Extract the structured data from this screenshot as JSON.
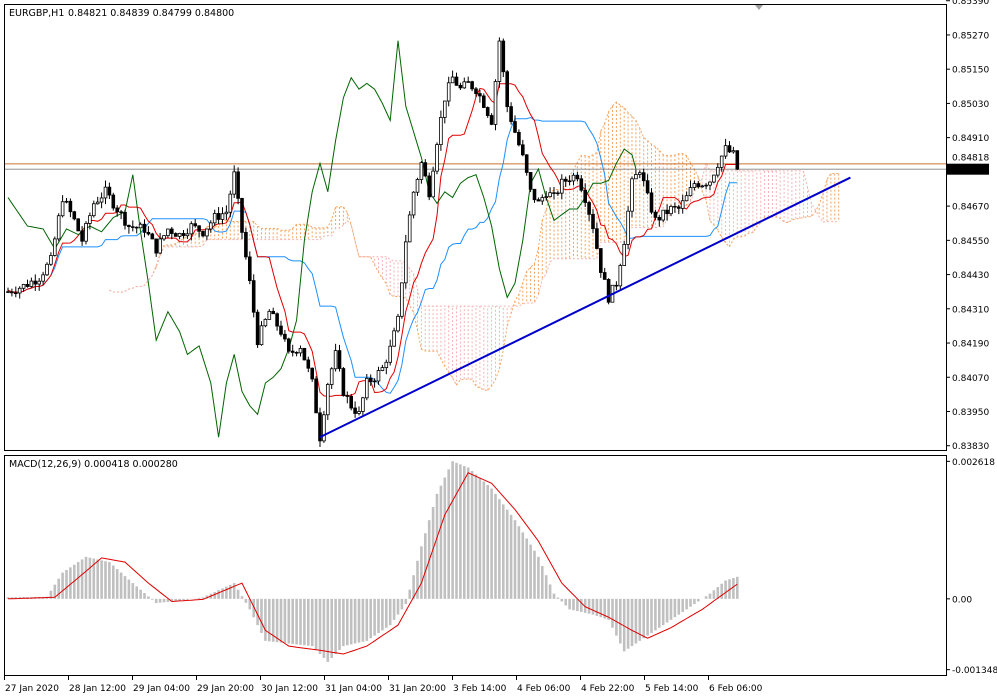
{
  "chart_data": {
    "type": "candlestick",
    "symbol_header": "EURGBP,H1",
    "ohlc_header": "0.84821 0.84839 0.84799 0.84800",
    "price_axis": {
      "ylim": [
        0.83815,
        0.85375
      ],
      "ticks": [
        "0.85390",
        "0.85270",
        "0.85150",
        "0.85030",
        "0.84910",
        "0.84670",
        "0.84550",
        "0.84430",
        "0.84310",
        "0.84190",
        "0.84070",
        "0.83950",
        "0.83830"
      ],
      "current_price_label": "0.84800",
      "hidden_level_label": "0.84818",
      "price_level_color": "#c87533",
      "current_price_tag_color": "#000000"
    },
    "time_axis": {
      "labels": [
        "27 Jan 2020",
        "28 Jan 12:00",
        "29 Jan 04:00",
        "29 Jan 20:00",
        "30 Jan 12:00",
        "31 Jan 04:00",
        "31 Jan 20:00",
        "3 Feb 14:00",
        "4 Feb 06:00",
        "4 Feb 22:00",
        "5 Feb 14:00",
        "6 Feb 06:00"
      ]
    },
    "close_path": [
      [
        0,
        0.8437
      ],
      [
        4,
        0.8439
      ],
      [
        8,
        0.8442
      ],
      [
        11,
        0.8448
      ],
      [
        14,
        0.847
      ],
      [
        17,
        0.8462
      ],
      [
        19,
        0.8455
      ],
      [
        22,
        0.8468
      ],
      [
        25,
        0.8472
      ],
      [
        28,
        0.8466
      ],
      [
        31,
        0.846
      ],
      [
        35,
        0.8459
      ],
      [
        38,
        0.8452
      ],
      [
        41,
        0.8459
      ],
      [
        44,
        0.8457
      ],
      [
        47,
        0.846
      ],
      [
        50,
        0.8458
      ],
      [
        53,
        0.8463
      ],
      [
        56,
        0.8465
      ],
      [
        58,
        0.8478
      ],
      [
        60,
        0.8458
      ],
      [
        62,
        0.844
      ],
      [
        64,
        0.842
      ],
      [
        67,
        0.843
      ],
      [
        70,
        0.8423
      ],
      [
        72,
        0.8415
      ],
      [
        75,
        0.8418
      ],
      [
        78,
        0.8405
      ],
      [
        80,
        0.8386
      ],
      [
        82,
        0.8405
      ],
      [
        84,
        0.8415
      ],
      [
        86,
        0.8402
      ],
      [
        88,
        0.8397
      ],
      [
        90,
        0.8394
      ],
      [
        92,
        0.8405
      ],
      [
        94,
        0.8407
      ],
      [
        96,
        0.841
      ],
      [
        98,
        0.8417
      ],
      [
        100,
        0.8427
      ],
      [
        102,
        0.8455
      ],
      [
        104,
        0.8472
      ],
      [
        106,
        0.8482
      ],
      [
        108,
        0.8472
      ],
      [
        110,
        0.849
      ],
      [
        112,
        0.8505
      ],
      [
        114,
        0.8512
      ],
      [
        116,
        0.8508
      ],
      [
        118,
        0.851
      ],
      [
        120,
        0.8508
      ],
      [
        122,
        0.8503
      ],
      [
        124,
        0.8497
      ],
      [
        126,
        0.8525
      ],
      [
        128,
        0.8502
      ],
      [
        130,
        0.8493
      ],
      [
        132,
        0.8484
      ],
      [
        134,
        0.8472
      ],
      [
        136,
        0.8468
      ],
      [
        138,
        0.8472
      ],
      [
        140,
        0.847
      ],
      [
        142,
        0.8475
      ],
      [
        144,
        0.8477
      ],
      [
        146,
        0.8478
      ],
      [
        148,
        0.847
      ],
      [
        150,
        0.846
      ],
      [
        152,
        0.8445
      ],
      [
        154,
        0.8435
      ],
      [
        156,
        0.844
      ],
      [
        158,
        0.8455
      ],
      [
        160,
        0.8475
      ],
      [
        162,
        0.848
      ],
      [
        164,
        0.847
      ],
      [
        166,
        0.8462
      ],
      [
        168,
        0.8464
      ],
      [
        170,
        0.8466
      ],
      [
        172,
        0.8466
      ],
      [
        174,
        0.847
      ],
      [
        176,
        0.8475
      ],
      [
        178,
        0.8475
      ],
      [
        180,
        0.8476
      ],
      [
        182,
        0.8482
      ],
      [
        184,
        0.8487
      ],
      [
        186,
        0.8485
      ],
      [
        187,
        0.848
      ]
    ],
    "trendline": {
      "from": [
        80,
        0.8386
      ],
      "to": [
        216,
        0.8477
      ],
      "color": "#0000cc"
    },
    "ichimoku_colors": {
      "tenkan": "#e00000",
      "kijun": "#1e90ff",
      "chikou": "#006400",
      "cloud_up": "#f4a460",
      "cloud_down": "#f5b5b5"
    },
    "macd": {
      "title": "MACD(12,26,9) 0.000418 0.000280",
      "ticks": [
        "0.002618",
        "0.00",
        "-0.001348"
      ],
      "ylim": [
        -0.00145,
        0.00272
      ],
      "histogram_color": "#c0c0c0",
      "signal_color": "#e00000",
      "hist_keys": [
        [
          0,
          3e-05
        ],
        [
          10,
          4e-05
        ],
        [
          14,
          0.0005
        ],
        [
          20,
          0.0008
        ],
        [
          26,
          0.0007
        ],
        [
          32,
          0.0003
        ],
        [
          38,
          -8e-05
        ],
        [
          44,
          -4e-05
        ],
        [
          50,
          3e-05
        ],
        [
          58,
          0.0003
        ],
        [
          62,
          -0.0002
        ],
        [
          66,
          -0.0008
        ],
        [
          72,
          -0.00085
        ],
        [
          78,
          -0.0009
        ],
        [
          82,
          -0.0012
        ],
        [
          86,
          -0.0009
        ],
        [
          92,
          -0.0008
        ],
        [
          98,
          -0.0005
        ],
        [
          102,
          -0.0001
        ],
        [
          106,
          0.001
        ],
        [
          110,
          0.002
        ],
        [
          114,
          0.00262
        ],
        [
          118,
          0.0025
        ],
        [
          124,
          0.0021
        ],
        [
          130,
          0.0015
        ],
        [
          136,
          0.0008
        ],
        [
          140,
          0.0001
        ],
        [
          144,
          -0.0002
        ],
        [
          150,
          -0.0003
        ],
        [
          154,
          -0.0004
        ],
        [
          158,
          -0.001
        ],
        [
          162,
          -0.0008
        ],
        [
          168,
          -0.0005
        ],
        [
          174,
          -0.0002
        ],
        [
          180,
          0.0001
        ],
        [
          184,
          0.00035
        ],
        [
          187,
          0.00042
        ]
      ],
      "signal_keys": [
        [
          0,
          0.0
        ],
        [
          12,
          3e-05
        ],
        [
          18,
          0.0004
        ],
        [
          24,
          0.00078
        ],
        [
          30,
          0.0007
        ],
        [
          36,
          0.0003
        ],
        [
          42,
          -5e-05
        ],
        [
          50,
          -1e-05
        ],
        [
          60,
          0.0003
        ],
        [
          66,
          -0.0006
        ],
        [
          72,
          -0.0009
        ],
        [
          80,
          -0.00098
        ],
        [
          86,
          -0.00105
        ],
        [
          92,
          -0.0009
        ],
        [
          100,
          -0.0005
        ],
        [
          106,
          0.0003
        ],
        [
          112,
          0.0016
        ],
        [
          118,
          0.0024
        ],
        [
          124,
          0.0022
        ],
        [
          130,
          0.0017
        ],
        [
          136,
          0.0011
        ],
        [
          142,
          0.0003
        ],
        [
          148,
          -0.00015
        ],
        [
          154,
          -0.00035
        ],
        [
          160,
          -0.0006
        ],
        [
          164,
          -0.00075
        ],
        [
          170,
          -0.00055
        ],
        [
          178,
          -0.0002
        ],
        [
          187,
          0.00028
        ]
      ]
    }
  }
}
